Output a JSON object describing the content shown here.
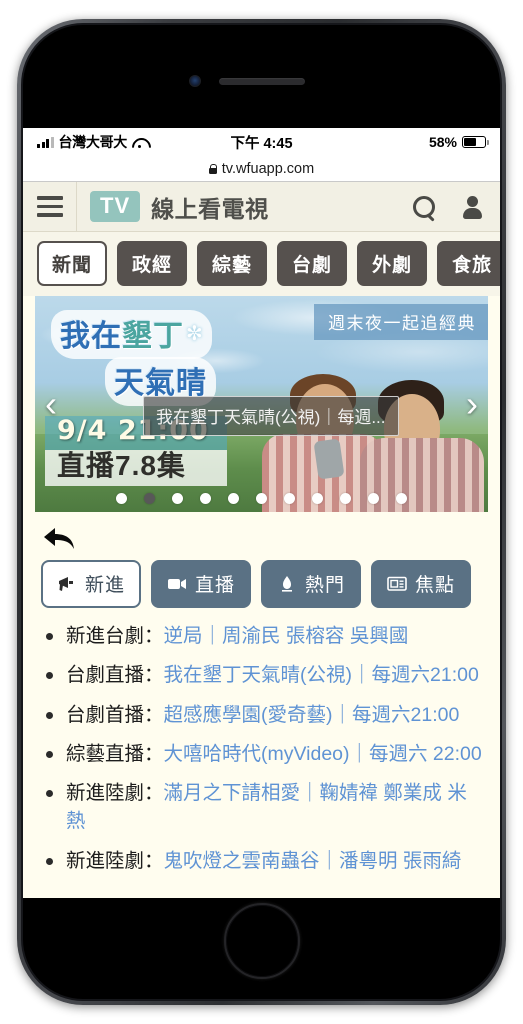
{
  "status_bar": {
    "carrier": "台灣大哥大",
    "time": "下午 4:45",
    "battery_percent": "58%",
    "signal_icon": "signal-bars-icon",
    "wifi_icon": "wifi-icon",
    "battery_icon": "battery-icon"
  },
  "browser": {
    "url": "tv.wfuapp.com",
    "lock_icon": "lock-icon"
  },
  "header": {
    "menu_icon": "hamburger-menu-icon",
    "logo_text": "TV",
    "title": "線上看電視",
    "search_icon": "search-icon",
    "account_icon": "user-account-icon",
    "logo_color": "#94c4bd"
  },
  "categories": [
    {
      "label": "新聞",
      "active": true
    },
    {
      "label": "政經",
      "active": false
    },
    {
      "label": "綜藝",
      "active": false
    },
    {
      "label": "台劇",
      "active": false
    },
    {
      "label": "外劇",
      "active": false
    },
    {
      "label": "食旅",
      "active": false
    }
  ],
  "carousel": {
    "ribbon": "週末夜一起追經典",
    "drama_title_line1_a": "我在",
    "drama_title_line1_b": "墾丁",
    "drama_title_line2": "天氣晴",
    "flower_icon": "flower-icon",
    "schedule_time": "9/4 21:00",
    "schedule_episode": "直播7.8集",
    "tooltip": "我在墾丁天氣晴(公視)｜每週...",
    "prev_arrow": "‹",
    "next_arrow": "›",
    "dot_count": 11,
    "active_dot_index": 1
  },
  "back_button": {
    "icon": "back-reply-arrow-icon"
  },
  "tabs": [
    {
      "label": "新進",
      "icon": "megaphone-icon",
      "active": true
    },
    {
      "label": "直播",
      "icon": "video-camera-icon",
      "active": false
    },
    {
      "label": "熱門",
      "icon": "flame-icon",
      "active": false
    },
    {
      "label": "焦點",
      "icon": "newspaper-icon",
      "active": false
    }
  ],
  "list_items": [
    {
      "category": "新進台劇：",
      "link": "逆局｜周渝民 張榕容 吳興國"
    },
    {
      "category": "台劇直播：",
      "link": "我在墾丁天氣晴(公視)｜每週六21:00"
    },
    {
      "category": "台劇首播：",
      "link": "超感應學園(愛奇藝)｜每週六21:00"
    },
    {
      "category": "綜藝直播：",
      "link": "大嘻哈時代(myVideo)｜每週六 22:00"
    },
    {
      "category": "新進陸劇：",
      "link": "滿月之下請相愛｜鞠婧褘 鄭業成 米熱"
    },
    {
      "category": "新進陸劇：",
      "link": "鬼吹燈之雲南蟲谷｜潘粵明 張雨綺"
    }
  ]
}
